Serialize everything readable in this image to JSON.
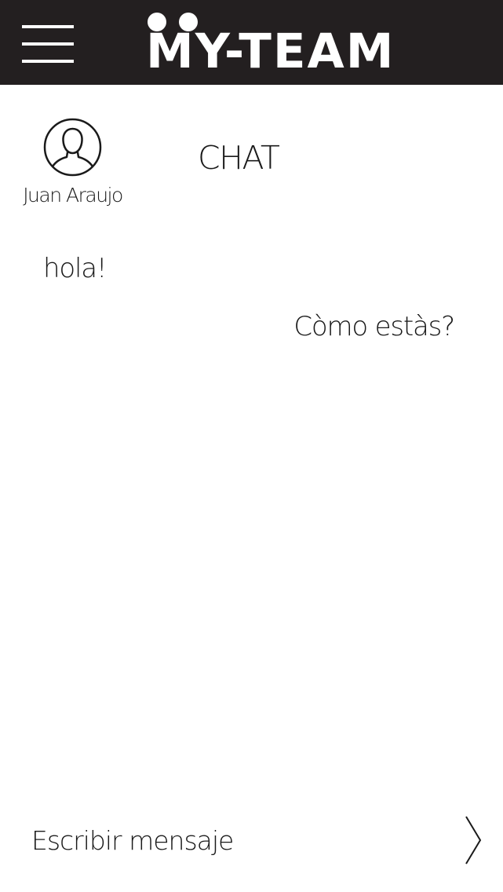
{
  "header": {
    "menu_icon": "hamburger-menu-icon",
    "logo_text": "MY-TEAM",
    "background_color": "#231f20"
  },
  "contact": {
    "avatar_icon": "user-avatar-icon",
    "name": "Juan Araujo"
  },
  "page": {
    "title": "CHAT"
  },
  "messages": [
    {
      "direction": "incoming",
      "text": "hola!"
    },
    {
      "direction": "outgoing",
      "text": "Còmo estàs?"
    }
  ],
  "composer": {
    "placeholder": "Escribir mensaje",
    "value": "",
    "send_icon": "chevron-right-icon"
  }
}
